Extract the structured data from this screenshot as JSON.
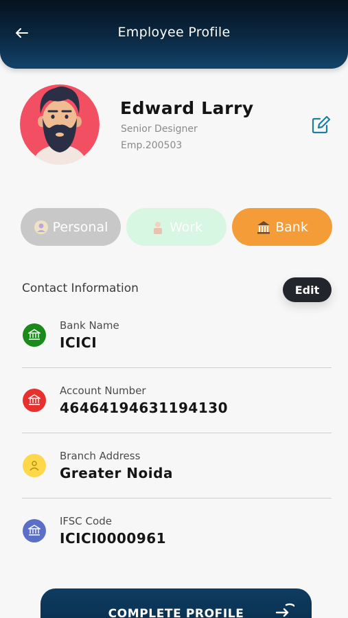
{
  "header": {
    "title": "Employee Profile",
    "back_icon": "arrow-left-icon"
  },
  "profile": {
    "name": "Edward Larry",
    "role": "Senior Designer",
    "employee_id": "Emp.200503",
    "avatar_icon": "bearded-man-avatar",
    "edit_icon": "pencil-square-icon"
  },
  "tabs": [
    {
      "label": "Personal",
      "icon": "person-id-icon",
      "color": "#c8c8c8",
      "active": false
    },
    {
      "label": "Work",
      "icon": "worker-icon",
      "color": "#d7f7e2",
      "active": false
    },
    {
      "label": "Bank",
      "icon": "bank-building-icon",
      "color": "#f49d38",
      "active": true
    }
  ],
  "section": {
    "title": "Contact Information",
    "edit_label": "Edit"
  },
  "fields": [
    {
      "label": "Bank Name",
      "value": "ICICI",
      "icon": "bank-icon",
      "color": "#1a8a1a"
    },
    {
      "label": "Account Number",
      "value": "46464194631194130",
      "icon": "bank-icon",
      "color": "#e8312e"
    },
    {
      "label": "Branch Address",
      "value": "Greater Noida",
      "icon": "person-pin-icon",
      "color": "#fdd84a"
    },
    {
      "label": "IFSC Code",
      "value": "ICICI0000961",
      "icon": "bank-icon",
      "color": "#5b6fc6"
    }
  ],
  "footer": {
    "button_label": "COMPLETE PROFILE",
    "button_icon": "arrow-right-circle-icon"
  }
}
